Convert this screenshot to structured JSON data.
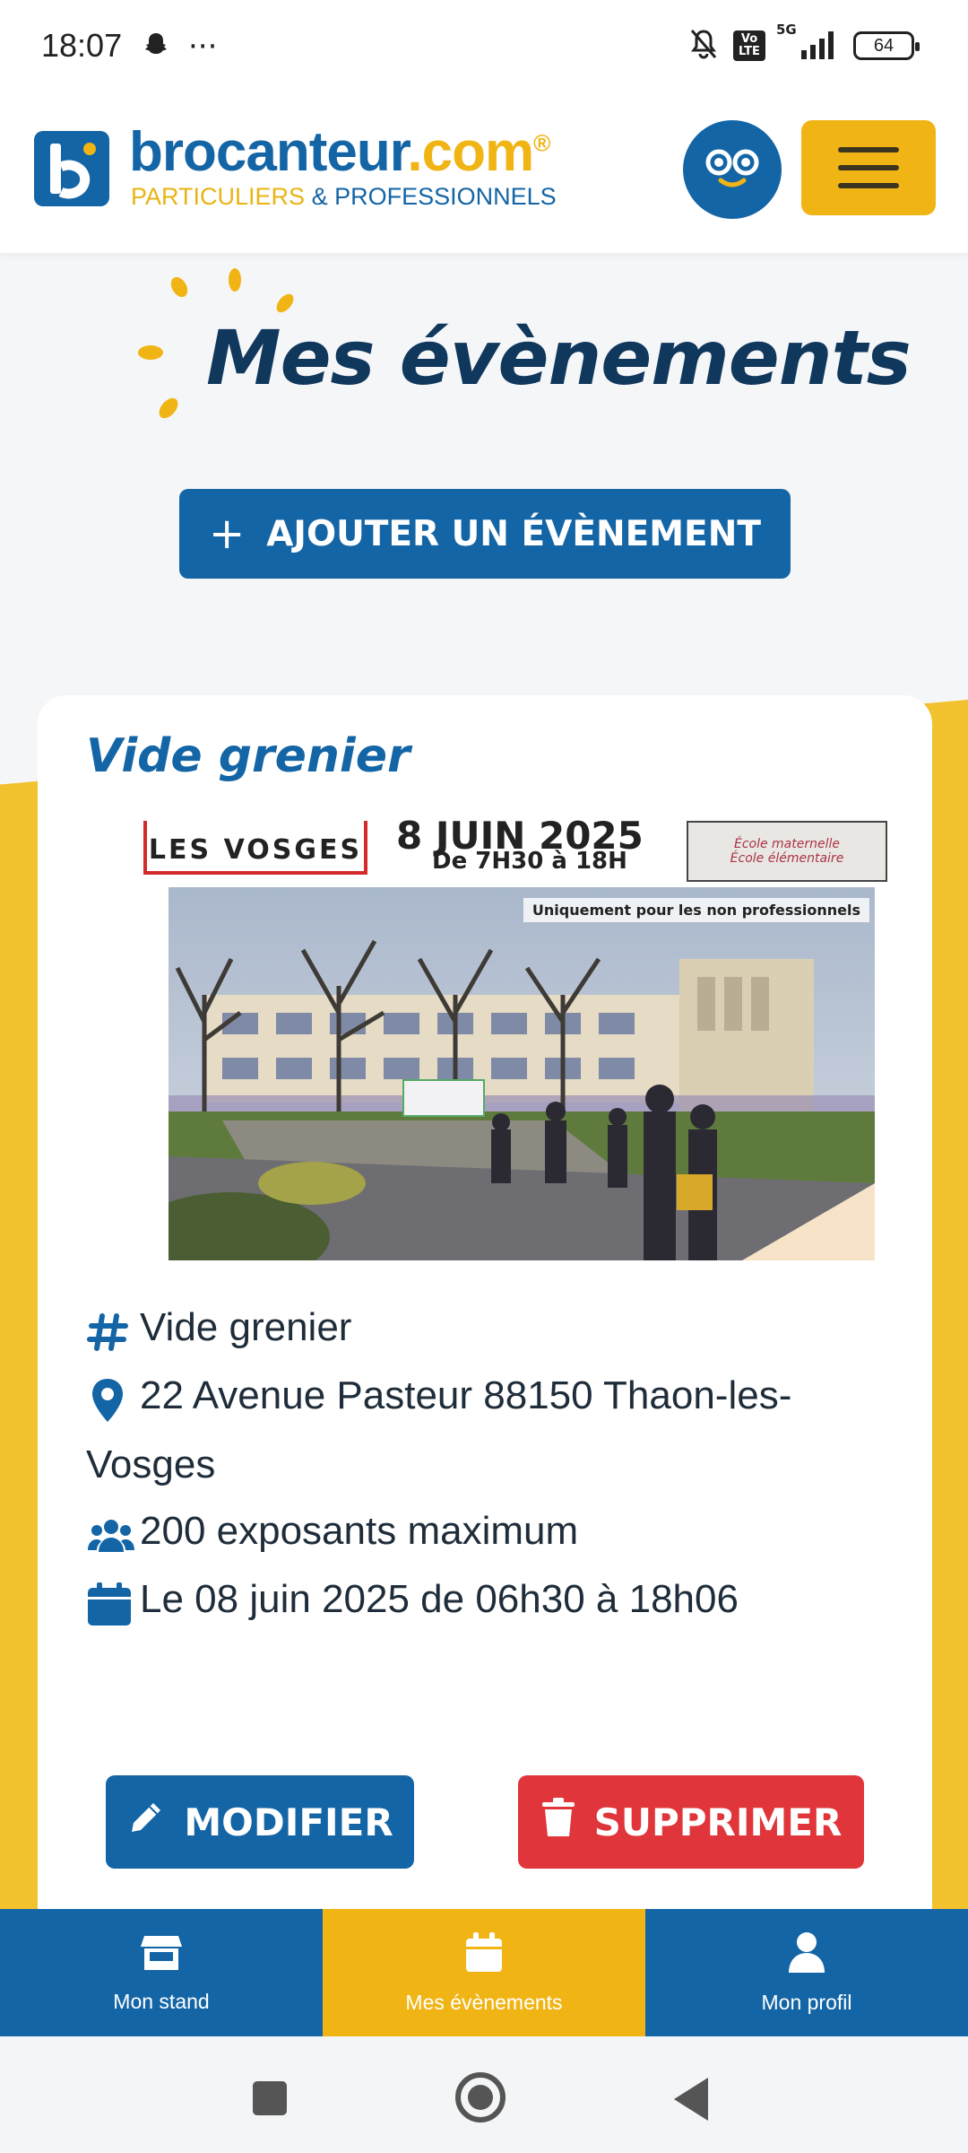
{
  "status_bar": {
    "time": "18:07",
    "more": "···",
    "network": "5G",
    "volte": "Vo LTE",
    "battery": "64"
  },
  "header": {
    "brand_main": "brocanteur",
    "brand_tld": ".com",
    "brand_reg": "®",
    "tagline_part": "PARTICULIERS",
    "tagline_rest": " & PROFESSIONNELS"
  },
  "page": {
    "title": "Mes évènements",
    "add_button": "AJOUTER UN ÉVÈNEMENT",
    "add_icon": "+"
  },
  "event": {
    "title": "Vide grenier",
    "poster": {
      "badge": "LES VOSGES",
      "date": "8 JUIN 2025",
      "hours": "De 7H30 à 18H",
      "school_line1": "École maternelle",
      "school_line2": "École élémentaire",
      "note": "Uniquement pour les non professionnels"
    },
    "category": "Vide grenier",
    "address": "22 Avenue Pasteur 88150 Thaon-les-Vosges",
    "exhibitors": "200 exposants maximum",
    "datetime": "Le 08 juin 2025 de 06h30 à 18h06",
    "edit_button": "MODIFIER",
    "delete_button": "SUPPRIMER"
  },
  "bottom_nav": {
    "items": [
      {
        "label": "Mon stand",
        "icon": "store-icon"
      },
      {
        "label": "Mes évènements",
        "icon": "calendar-icon",
        "active": true
      },
      {
        "label": "Mon profil",
        "icon": "user-icon"
      }
    ]
  },
  "colors": {
    "brand_blue": "#1465a6",
    "brand_yellow": "#f0b414",
    "danger_red": "#e0353a",
    "title_navy": "#10375c"
  }
}
